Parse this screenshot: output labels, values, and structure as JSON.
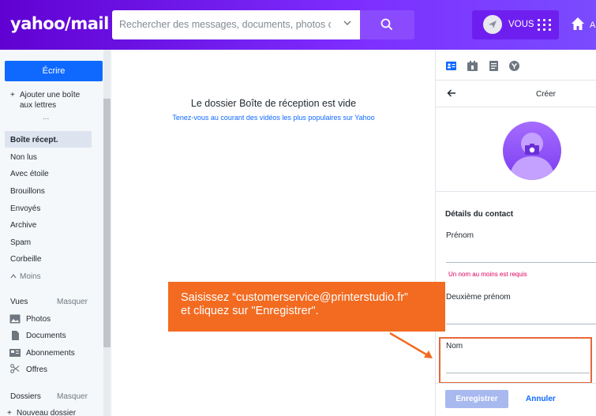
{
  "header": {
    "logo": "yahoo/mail",
    "search_placeholder": "Rechercher des messages, documents, photos ou c",
    "user_label": "VOUS",
    "home_label": "A"
  },
  "sidebar": {
    "compose_label": "Écrire",
    "add_mailbox": "Ajouter une boîte aux lettres",
    "more_dots": "...",
    "folders": [
      "Boîte récept.",
      "Non lus",
      "Avec étoile",
      "Brouillons",
      "Envoyés",
      "Archive",
      "Spam",
      "Corbeille"
    ],
    "less_label": "Moins",
    "views_label": "Vues",
    "views_hide": "Masquer",
    "views": [
      {
        "label": "Photos",
        "icon": "image-icon"
      },
      {
        "label": "Documents",
        "icon": "document-icon"
      },
      {
        "label": "Abonnements",
        "icon": "newsletter-icon"
      },
      {
        "label": "Offres",
        "icon": "scissors-icon"
      }
    ],
    "folders_label": "Dossiers",
    "folders_hide": "Masquer",
    "new_folder": "Nouveau dossier"
  },
  "main": {
    "empty_title": "Le dossier Boîte de réception est vide",
    "empty_link": "Tenez-vous au courant des vidéos les plus populaires sur Yahoo"
  },
  "contact_panel": {
    "header_title": "Créer",
    "section_title": "Détails du contact",
    "first_name_label": "Prénom",
    "error_message": "Un nom au moins est requis",
    "middle_name_label": "Deuxième prénom",
    "last_name_label": "Nom",
    "save_label": "Enregistrer",
    "cancel_label": "Annuler"
  },
  "callout": {
    "line1": "Saisissez “customerservice@printerstudio.fr”",
    "line2": "et cliquez sur \"Enregistrer\"."
  },
  "colors": {
    "brand": "#6001d2",
    "compose": "#0f69ff",
    "callout": "#f26b21",
    "error": "#e0005e"
  }
}
